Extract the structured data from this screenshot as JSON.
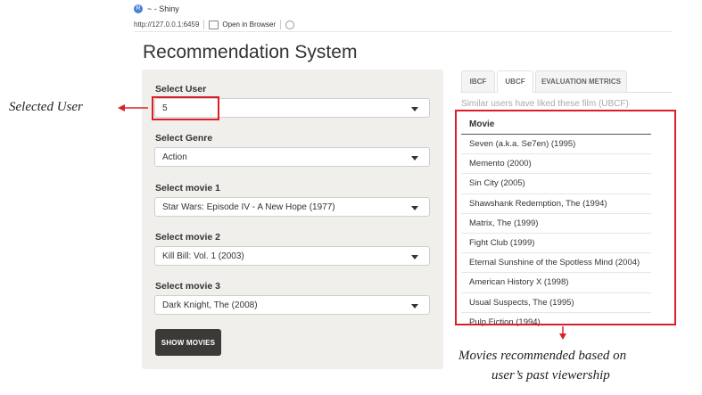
{
  "window": {
    "title": "~ - Shiny",
    "app_icon_letter": "R"
  },
  "toolbar": {
    "url": "http://127.0.0.1:6459",
    "open_browser_label": "Open in Browser"
  },
  "page": {
    "title": "Recommendation System"
  },
  "sidebar": {
    "fields": [
      {
        "label": "Select User",
        "value": "5"
      },
      {
        "label": "Select Genre",
        "value": "Action"
      },
      {
        "label": "Select movie 1",
        "value": "Star Wars: Episode IV - A New Hope (1977)"
      },
      {
        "label": "Select movie 2",
        "value": "Kill Bill: Vol. 1 (2003)"
      },
      {
        "label": "Select movie 3",
        "value": "Dark Knight, The (2008)"
      }
    ],
    "show_button_label": "SHOW MOVIES"
  },
  "tabs": [
    {
      "label": "IBCF",
      "active": false
    },
    {
      "label": "UBCF",
      "active": true
    },
    {
      "label": "EVALUATION METRICS",
      "active": false
    }
  ],
  "results": {
    "caption": "Similar users have liked these film (UBCF)",
    "column_header": "Movie",
    "rows": [
      "Seven (a.k.a. Se7en) (1995)",
      "Memento (2000)",
      "Sin City (2005)",
      "Shawshank Redemption, The (1994)",
      "Matrix, The (1999)",
      "Fight Club (1999)",
      "Eternal Sunshine of the Spotless Mind (2004)",
      "American History X (1998)",
      "Usual Suspects, The (1995)",
      "Pulp Fiction (1994)"
    ]
  },
  "annotations": {
    "selected_user": "Selected User",
    "recommended_line1": "Movies recommended based on",
    "recommended_line2": "user’s past viewership",
    "color": "#d92028"
  }
}
